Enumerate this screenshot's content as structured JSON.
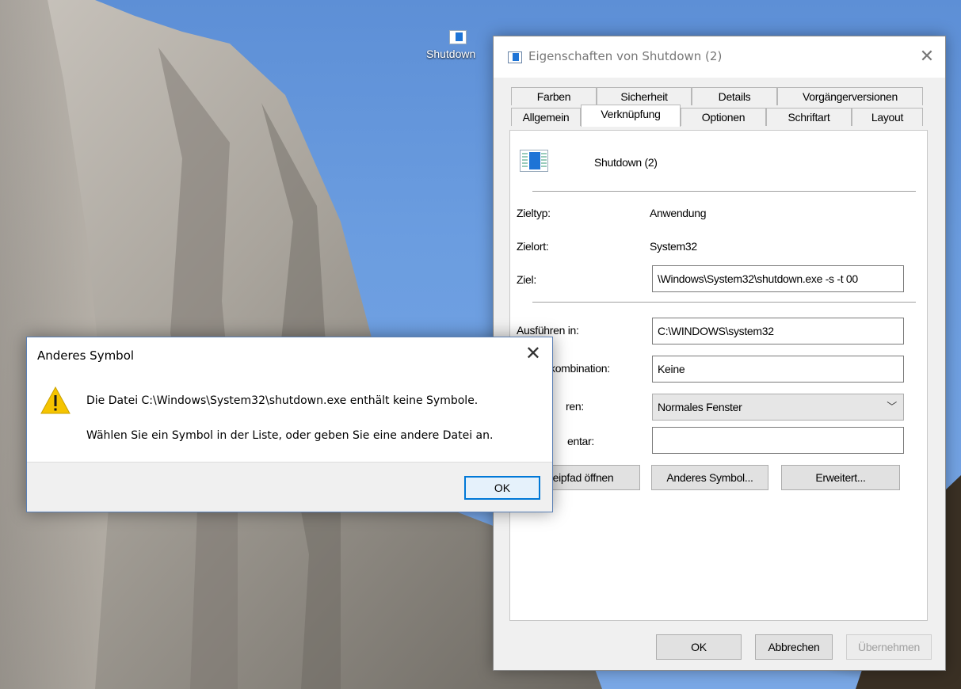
{
  "desktop": {
    "icon_label": "Shutdown"
  },
  "props_window": {
    "title": "Eigenschaften von Shutdown (2)",
    "tabs_top": [
      "Farben",
      "Sicherheit",
      "Details",
      "Vorgängerversionen"
    ],
    "tabs_bottom": [
      "Allgemein",
      "Verknüpfung",
      "Optionen",
      "Schriftart",
      "Layout"
    ],
    "active_tab": "Verknüpfung",
    "shortcut_name": "Shutdown (2)",
    "zieltyp_label": "Zieltyp:",
    "zieltyp_value": "Anwendung",
    "zielort_label": "Zielort:",
    "zielort_value": "System32",
    "ziel_label": "Ziel:",
    "ziel_value": "\\Windows\\System32\\shutdown.exe -s -t 00",
    "ausfuehren_label": "Ausführen in:",
    "ausfuehren_value": "C:\\WINDOWS\\system32",
    "tastenkombination_label": "kombination:",
    "tastenkombination_value": "Keine",
    "ausfuehren2_label": "ren:",
    "ausfuehren2_value": "Normales Fenster",
    "kommentar_label": "entar:",
    "kommentar_value": "",
    "btn_dateipfad": "eipfad öffnen",
    "btn_anderes_symbol": "Anderes Symbol...",
    "btn_erweitert": "Erweitert...",
    "btn_ok": "OK",
    "btn_abbrechen": "Abbrechen",
    "btn_uebernehmen": "Übernehmen"
  },
  "alert": {
    "title": "Anderes Symbol",
    "message_line1": "Die Datei C:\\Windows\\System32\\shutdown.exe enthält keine Symbole.",
    "message_line2": "Wählen Sie ein Symbol in der Liste, oder geben Sie eine andere Datei an.",
    "ok_label": "OK",
    "warning_icon": "warning-icon"
  },
  "colors": {
    "accent": "#0078d7",
    "shortcut_icon_blue": "#1e74d6",
    "warning_yellow": "#f5c400"
  }
}
